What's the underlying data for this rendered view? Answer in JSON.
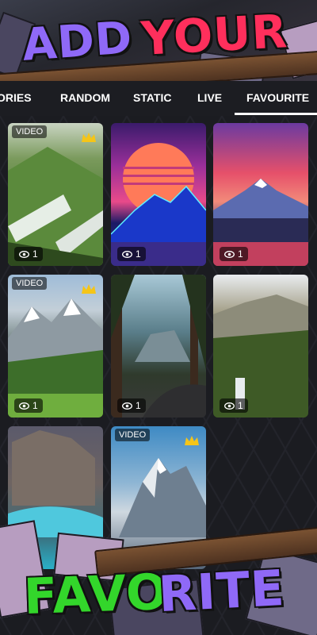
{
  "banner": {
    "top_word_1": "ADD",
    "top_word_2": "YOUR",
    "bottom_word_1": "FAVO",
    "bottom_word_2": "RITE"
  },
  "tabs": [
    {
      "label": "ORIES"
    },
    {
      "label": "RANDOM"
    },
    {
      "label": "STATIC"
    },
    {
      "label": "LIVE"
    },
    {
      "label": "FAVOURITE",
      "selected": true
    }
  ],
  "cards": [
    {
      "badge": "VIDEO",
      "premium": true,
      "views": "1",
      "scene": "green-mountain-valley"
    },
    {
      "badge": "",
      "premium": false,
      "views": "1",
      "scene": "synthwave-mountain"
    },
    {
      "badge": "",
      "premium": false,
      "views": "1",
      "scene": "pink-sky-mountain"
    },
    {
      "badge": "VIDEO",
      "premium": true,
      "views": "1",
      "scene": "alpine-meadow"
    },
    {
      "badge": "",
      "premium": false,
      "views": "1",
      "scene": "forest-road-half-dome"
    },
    {
      "badge": "",
      "premium": false,
      "views": "1",
      "scene": "waterfall-valley"
    },
    {
      "badge": "",
      "premium": false,
      "views": "",
      "scene": "sea-cliff-waves"
    },
    {
      "badge": "VIDEO",
      "premium": true,
      "views": "",
      "scene": "snowy-peak"
    }
  ],
  "icons": {
    "views": "eye-icon",
    "premium": "crown-icon"
  },
  "colors": {
    "tab_text": "#ffffff",
    "indicator": "#ffffff",
    "word_purple": "#8f69f7",
    "word_red": "#ff2f5c",
    "word_green": "#33d62b",
    "crown": "#f5c518"
  }
}
